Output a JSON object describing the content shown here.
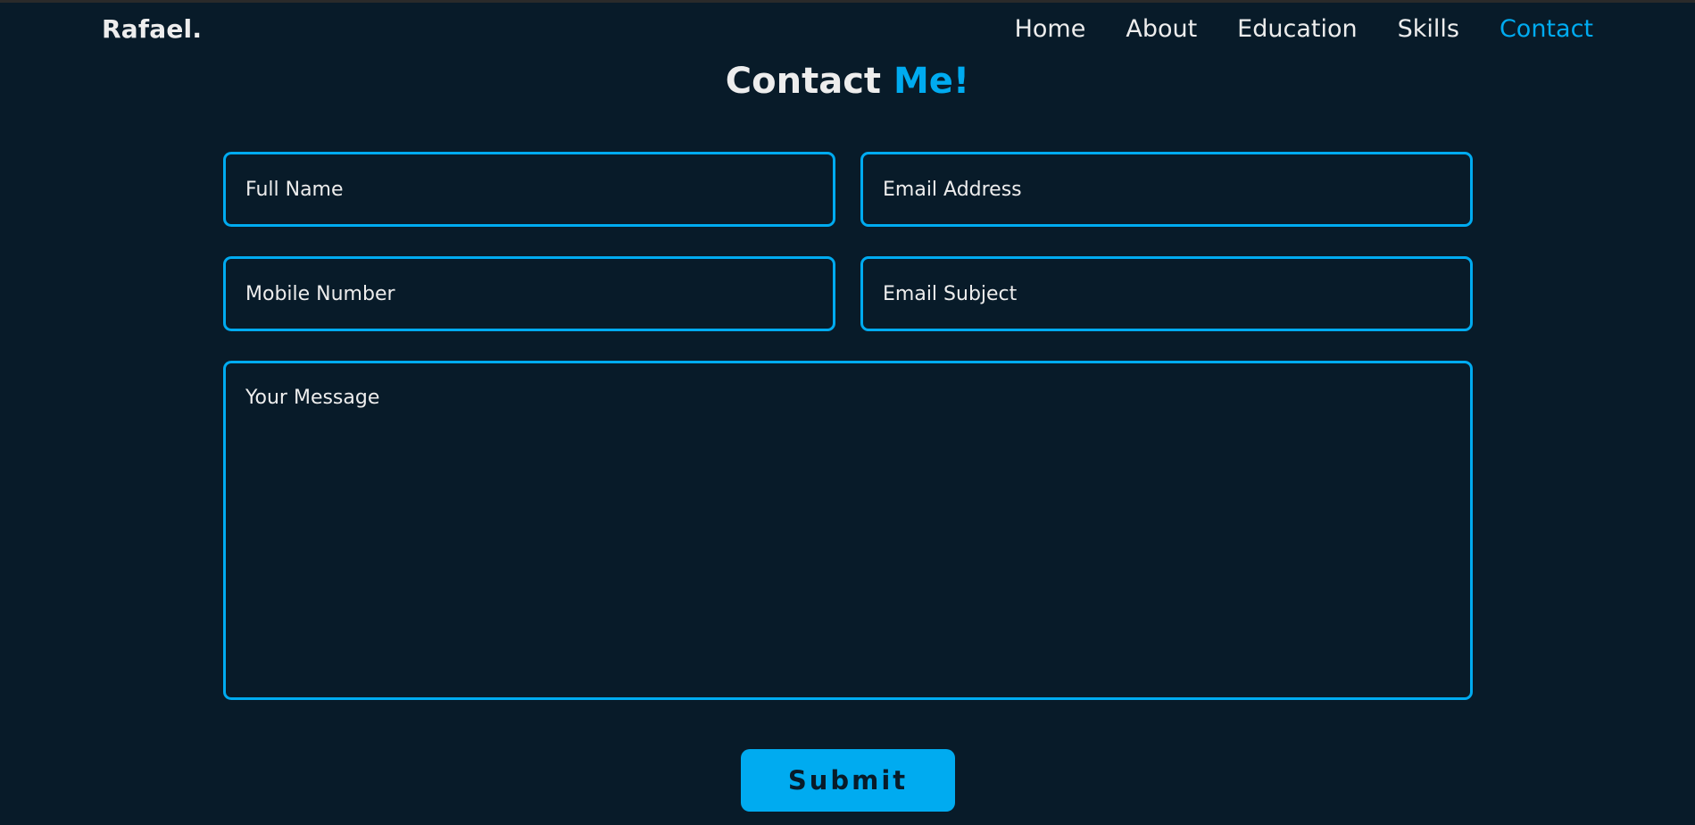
{
  "header": {
    "logo": "Rafael.",
    "nav": [
      {
        "label": "Home"
      },
      {
        "label": "About"
      },
      {
        "label": "Education"
      },
      {
        "label": "Skills"
      },
      {
        "label": "Contact"
      }
    ],
    "active_nav": "Contact"
  },
  "contact": {
    "title_main": "Contact",
    "title_accent": "Me!",
    "full_name": {
      "value": "",
      "placeholder": "Full Name"
    },
    "email": {
      "value": "",
      "placeholder": "Email Address"
    },
    "mobile": {
      "value": "",
      "placeholder": "Mobile Number"
    },
    "subject": {
      "value": "",
      "placeholder": "Email Subject"
    },
    "message": {
      "value": "",
      "placeholder": "Your Message"
    },
    "submit_label": "Submit"
  },
  "colors": {
    "background": "#081b29",
    "accent": "#00abf0",
    "text": "#ededed"
  }
}
